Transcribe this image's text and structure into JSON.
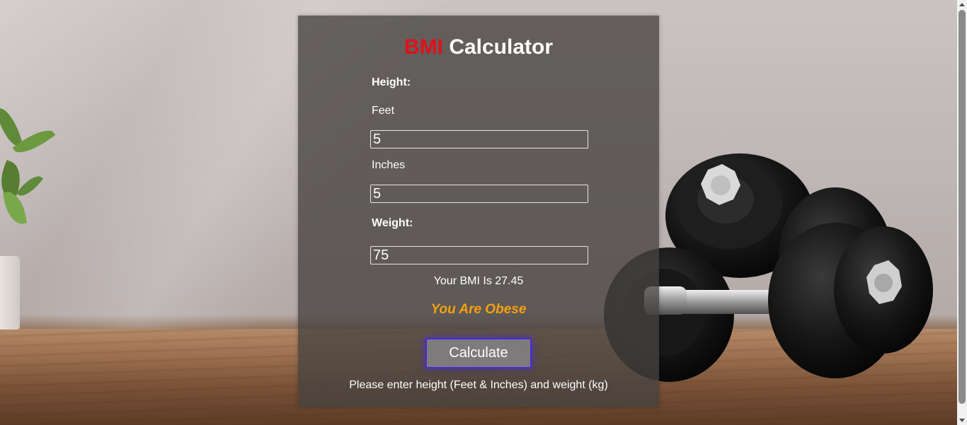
{
  "header": {
    "title_accent": "BMI",
    "title_rest": "Calculator"
  },
  "form": {
    "height_label": "Height:",
    "feet_label": "Feet",
    "feet_value": "5",
    "inches_label": "Inches",
    "inches_value": "5",
    "weight_label": "Weight:",
    "weight_value": "75"
  },
  "result": {
    "bmi_text": "Your BMI Is 27.45",
    "status_text": "You Are Obese"
  },
  "actions": {
    "calculate_label": "Calculate"
  },
  "hint": "Please enter height (Feet & Inches) and weight (kg)",
  "colors": {
    "accent": "#e0101a",
    "status": "#f5a00f",
    "button_glow": "#4a2bd0"
  }
}
